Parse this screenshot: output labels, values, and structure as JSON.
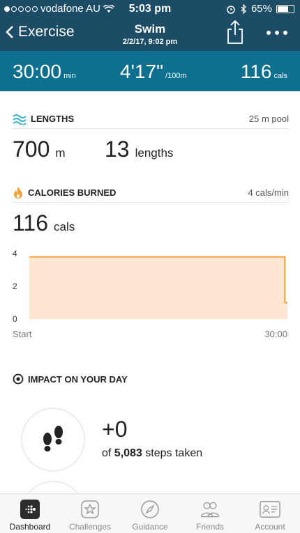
{
  "status_bar": {
    "carrier": "vodafone AU",
    "time": "5:03 pm",
    "battery": "65%"
  },
  "header": {
    "back_label": "Exercise",
    "title": "Swim",
    "subtitle": "2/2/17, 9:02 pm"
  },
  "summary": {
    "duration": "30:00",
    "duration_unit": "min",
    "pace": "4'17\"",
    "pace_unit": "/100m",
    "calories": "116",
    "calories_unit": "cals"
  },
  "lengths": {
    "title": "LENGTHS",
    "meta": "25 m pool",
    "distance": "700",
    "distance_unit": "m",
    "count": "13",
    "count_unit": "lengths"
  },
  "calories": {
    "title": "CALORIES BURNED",
    "meta": "4 cals/min",
    "value": "116",
    "unit": "cals"
  },
  "chart_data": {
    "type": "area",
    "x": [
      "Start",
      "30:00"
    ],
    "x_minutes": [
      0,
      29.7,
      29.7,
      30
    ],
    "y_values": [
      3.8,
      3.8,
      1.0,
      1.0
    ],
    "yticks": [
      0,
      2,
      4
    ],
    "ylim": [
      0,
      4
    ],
    "xlabel": "",
    "ylabel": "",
    "x_tick_labels": [
      "Start",
      "30:00"
    ],
    "line_color": "#f5a13a",
    "fill_color": "#fde7d3"
  },
  "impact": {
    "title": "IMPACT ON YOUR DAY",
    "steps_value": "+0",
    "steps_prefix": "of",
    "steps_total": "5,083",
    "steps_suffix": "steps taken"
  },
  "tabs": [
    {
      "label": "Dashboard",
      "icon": "dashboard-icon",
      "active": true
    },
    {
      "label": "Challenges",
      "icon": "star-badge-icon",
      "active": false
    },
    {
      "label": "Guidance",
      "icon": "compass-icon",
      "active": false
    },
    {
      "label": "Friends",
      "icon": "friends-icon",
      "active": false
    },
    {
      "label": "Account",
      "icon": "account-card-icon",
      "active": false
    }
  ],
  "colors": {
    "header_bg": "#1d4d66",
    "summary_bg": "#0e6f8e",
    "accent_orange": "#f5a13a",
    "swim_teal": "#39b3c7"
  }
}
